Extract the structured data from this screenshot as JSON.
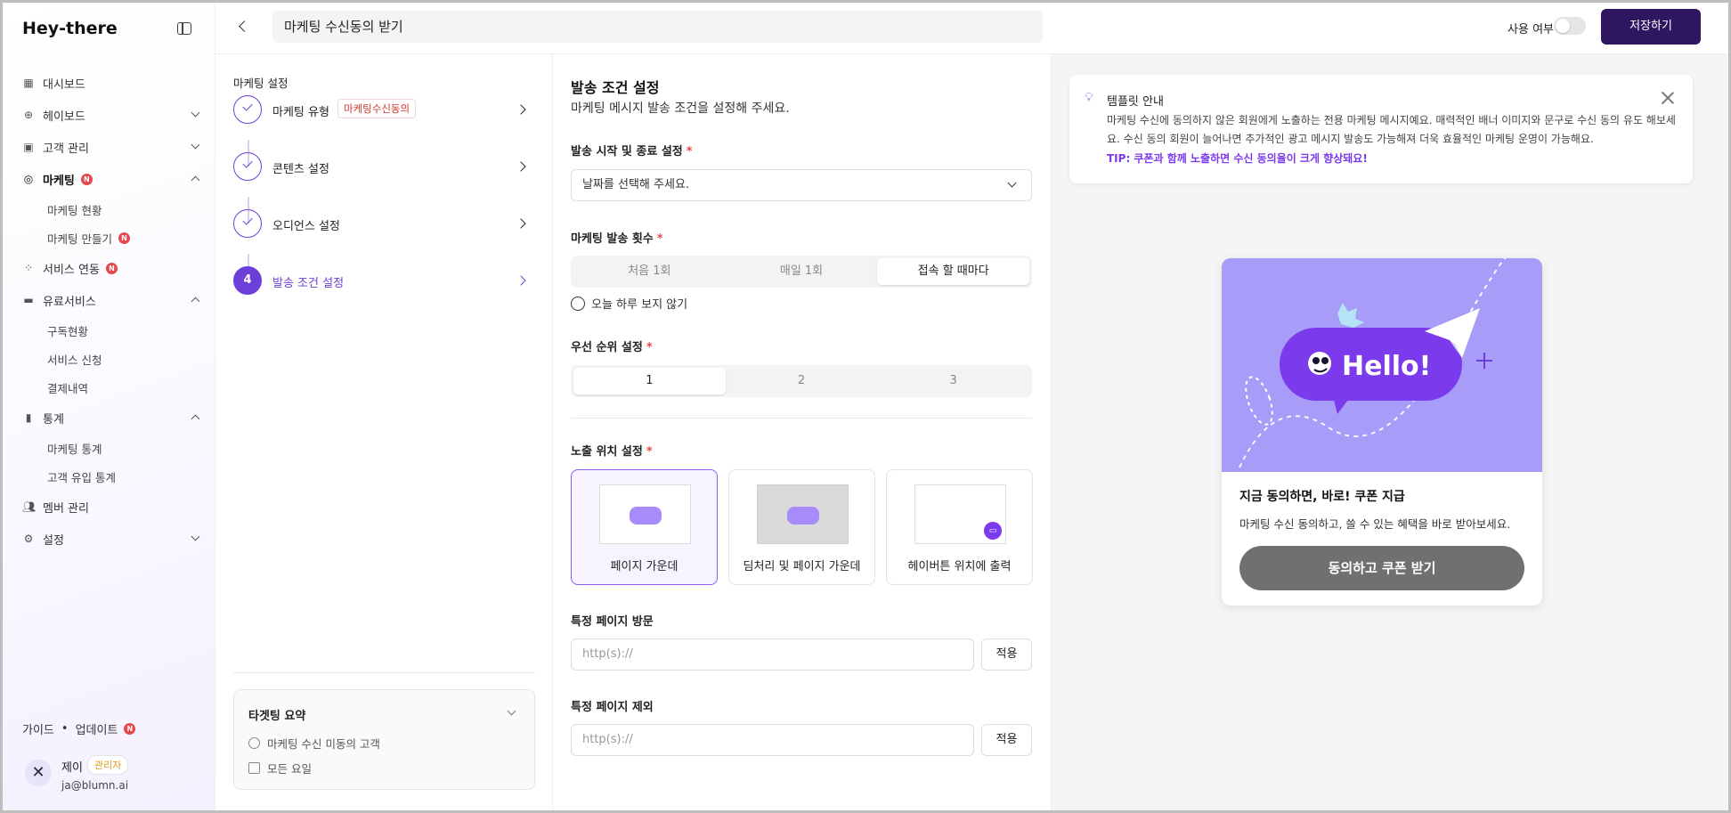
{
  "app": {
    "logo": "Hey-there"
  },
  "sidebar": {
    "items": [
      {
        "label": "대시보드",
        "icon": "dashboard-icon"
      },
      {
        "label": "헤이보드",
        "icon": "plus-circle-icon"
      },
      {
        "label": "고객 관리",
        "icon": "chat-user-icon"
      },
      {
        "label": "마케팅",
        "icon": "marketing-icon",
        "badge": "N",
        "active": true,
        "children": [
          {
            "label": "마케팅 현황"
          },
          {
            "label": "마케팅 만들기",
            "badge": "N"
          }
        ]
      },
      {
        "label": "서비스 연동",
        "icon": "grid-icon",
        "badge": "N"
      },
      {
        "label": "유료서비스",
        "icon": "card-icon",
        "children": [
          {
            "label": "구독현황"
          },
          {
            "label": "서비스 신청"
          },
          {
            "label": "결제내역"
          }
        ]
      },
      {
        "label": "통계",
        "icon": "bar-chart-icon",
        "children": [
          {
            "label": "마케팅 통계"
          },
          {
            "label": "고객 유입 통계"
          }
        ]
      },
      {
        "label": "멤버 관리",
        "icon": "users-icon"
      },
      {
        "label": "설정",
        "icon": "gear-icon"
      }
    ],
    "footer": {
      "guide": "가이드",
      "update": "업데이트",
      "update_badge": "N"
    },
    "profile": {
      "avatar": "✕",
      "name": "제이",
      "role": "관리자",
      "email": "ja@blumn.ai"
    }
  },
  "topbar": {
    "title": "마케팅 수신동의 받기",
    "use_label": "사용 여부",
    "toggle_on": false,
    "save_label": "저장하기"
  },
  "steps": {
    "title": "마케팅 설정",
    "items": [
      {
        "label": "마케팅 유형",
        "tag": "마케팅수신동의",
        "done": true
      },
      {
        "label": "콘텐츠 설정",
        "done": true
      },
      {
        "label": "오디언스 설정",
        "done": true
      },
      {
        "label": "발송 조건 설정",
        "number": "4",
        "active": true
      }
    ],
    "summary": {
      "title": "타겟팅 요약",
      "rows": [
        "마케팅 수신 미동의 고객",
        "모든 요일"
      ]
    }
  },
  "form": {
    "title": "발송 조건 설정",
    "description": "마케팅 메시지 발송 조건을 설정해 주세요.",
    "date": {
      "label": "발송 시작 및 종료 설정",
      "placeholder": "날짜를 선택해 주세요."
    },
    "frequency": {
      "label": "마케팅 발송 횟수",
      "options": [
        "처음 1회",
        "매일 1회",
        "접속 할 때마다"
      ],
      "selected": 2
    },
    "hide_today": "오늘 하루 보지 않기",
    "priority": {
      "label": "우선 순위 설정",
      "options": [
        "1",
        "2",
        "3"
      ],
      "selected": 0
    },
    "position": {
      "label": "노출 위치 설정",
      "options": [
        "페이지 가운데",
        "딤처리 및 페이지 가운데",
        "헤이버튼 위치에 출력"
      ],
      "selected": 0
    },
    "visit": {
      "label": "특정 페이지 방문",
      "placeholder": "http(s)://",
      "apply": "적용"
    },
    "exclude": {
      "label": "특정 페이지 제외",
      "placeholder": "http(s)://",
      "apply": "적용"
    },
    "required_mark": "*"
  },
  "preview": {
    "tip": {
      "title": "템플릿 안내",
      "body": "마케팅 수신에 동의하지 않은 회원에게 노출하는 전용 마케팅 메시지예요. 매력적인 배너 이미지와 문구로 수신 동의 유도 해보세요. 수신 동의 회원이 늘어나면 추가적인 광고 메시지 발송도 가능해져 더욱 효율적인 마케팅 운영이 가능해요.",
      "tip": "TIP: 쿠폰과 함께 노출하면 수신 동의율이 크게 향상돼요!"
    },
    "popup": {
      "banner_text": "Hello!",
      "headline": "지금 동의하면, 바로! 쿠폰 지급",
      "description": "마케팅 수신 동의하고, 쓸 수 있는 혜택을 바로 받아보세요.",
      "button": "동의하고 쿠폰 받기"
    }
  },
  "colors": {
    "brand": "#2e1660",
    "accent": "#6d3fd9",
    "danger": "#e5484d",
    "banner": "#a79cf7",
    "bubble": "#7c3aed"
  }
}
